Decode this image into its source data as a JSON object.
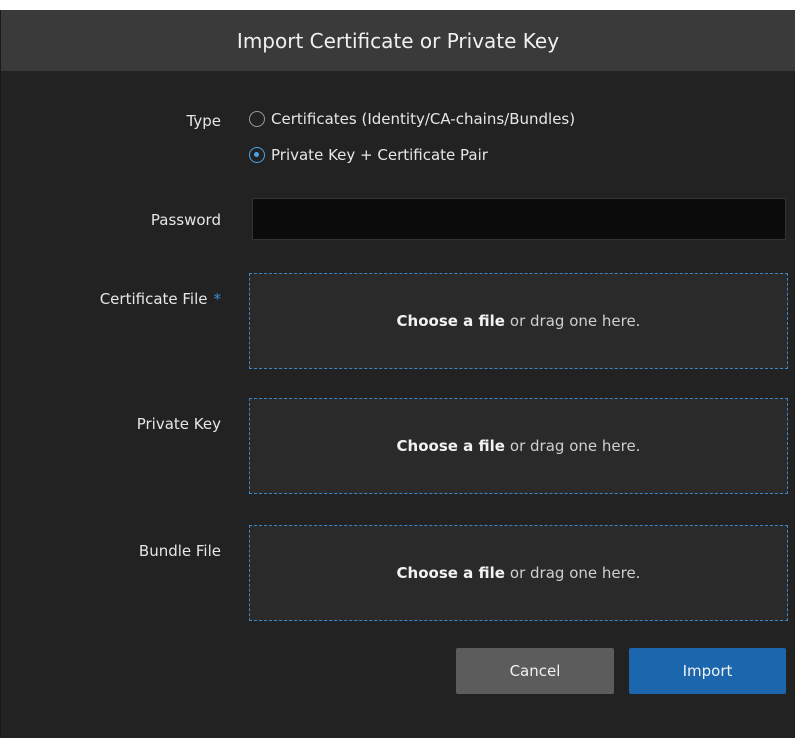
{
  "dialog": {
    "title": "Import Certificate or Private Key"
  },
  "form": {
    "type": {
      "label": "Type",
      "options": [
        {
          "label": "Certificates (Identity/CA-chains/Bundles)",
          "selected": false
        },
        {
          "label": "Private Key + Certificate Pair",
          "selected": true
        }
      ]
    },
    "password": {
      "label": "Password",
      "value": "",
      "placeholder": ""
    },
    "certificate_file": {
      "label": "Certificate File",
      "required_marker": "*",
      "choose": "Choose a file",
      "drag": "or drag one here."
    },
    "private_key": {
      "label": "Private Key",
      "choose": "Choose a file",
      "drag": "or drag one here."
    },
    "bundle_file": {
      "label": "Bundle File",
      "choose": "Choose a file",
      "drag": "or drag one here."
    }
  },
  "buttons": {
    "cancel": "Cancel",
    "import": "Import"
  },
  "colors": {
    "accent": "#1b66ad",
    "dialog_bg": "#222222",
    "header_bg": "#3a3a3a",
    "dropzone_border": "#3c86c6"
  }
}
